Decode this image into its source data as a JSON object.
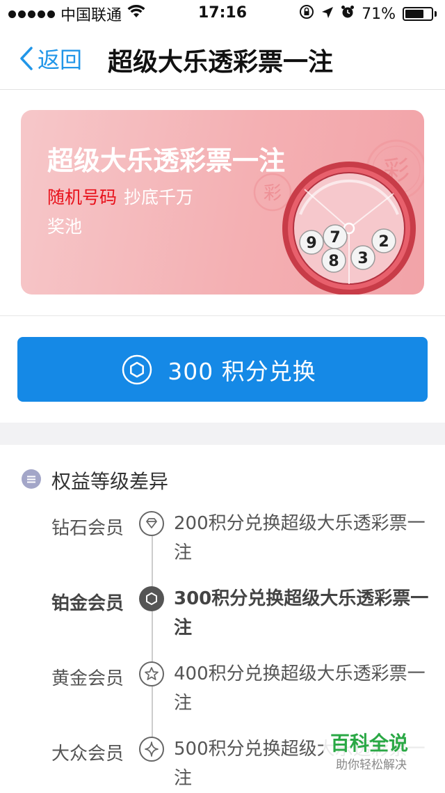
{
  "status_bar": {
    "carrier": "中国联通",
    "time": "17:16",
    "battery_percent": "71%",
    "battery_level": 0.71,
    "icons": [
      "signal-dots-icon",
      "wifi-icon",
      "rotation-lock-icon",
      "location-arrow-icon",
      "alarm-icon",
      "battery-icon"
    ]
  },
  "nav": {
    "back_label": "返回",
    "title": "超级大乐透彩票一注"
  },
  "banner": {
    "title": "超级大乐透彩票一注",
    "random_label": "随机号码",
    "floor_label": "抄底千万",
    "pool_label": "奖池",
    "stamp_char": "彩",
    "balls": [
      "9",
      "7",
      "8",
      "3",
      "2"
    ]
  },
  "redeem": {
    "points": "300",
    "label": "积分兑换"
  },
  "benefits": {
    "title": "权益等级差异",
    "tiers": [
      {
        "name": "钻石会员",
        "desc": "200积分兑换超级大乐透彩票一注",
        "icon": "diamond-icon",
        "active": false
      },
      {
        "name": "铂金会员",
        "desc": "300积分兑换超级大乐透彩票一注",
        "icon": "hexagon-icon",
        "active": true
      },
      {
        "name": "黄金会员",
        "desc": "400积分兑换超级大乐透彩票一注",
        "icon": "star-icon",
        "active": false
      },
      {
        "name": "大众会员",
        "desc": "500积分兑换超级大乐透彩票一注",
        "icon": "sparkle-icon",
        "active": false
      }
    ]
  },
  "watermark": {
    "title": "百科全说",
    "subtitle": "助你轻松解决"
  },
  "colors": {
    "accent": "#1589e6",
    "back_link": "#2196e8",
    "banner_red": "#e8101a",
    "banner_bg": "#f4b0b3",
    "watermark_green": "#2aa845"
  }
}
